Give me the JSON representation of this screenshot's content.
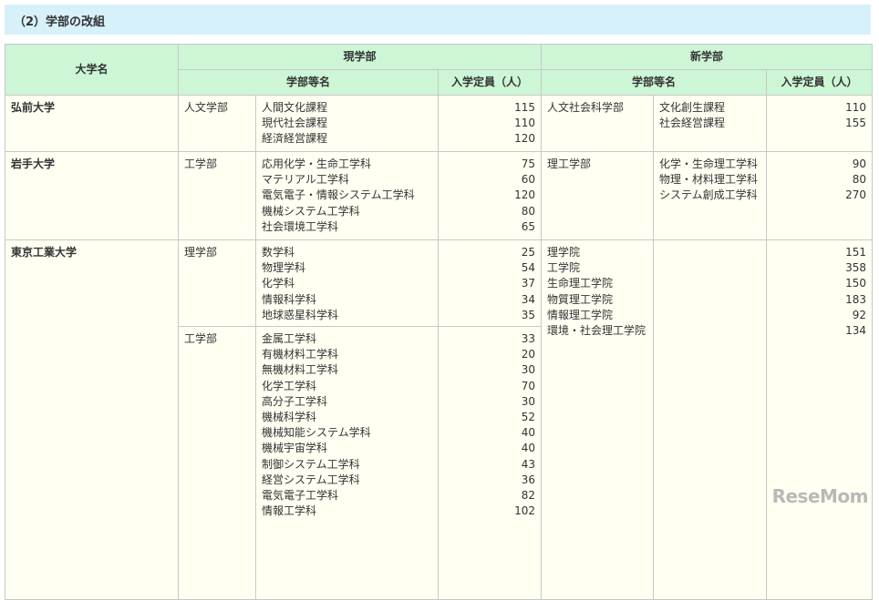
{
  "section_title": "（2）学部の改組",
  "table": {
    "headers": {
      "university": "大学名",
      "current": "現学部",
      "new": "新学部",
      "faculty_name": "学部等名",
      "capacity": "入学定員（人）"
    },
    "rows": [
      {
        "university": "弘前大学",
        "current": [
          {
            "faculty": "人文学部",
            "departments": [
              "人間文化課程",
              "現代社会課程",
              "経済経営課程"
            ],
            "capacities": [
              "115",
              "110",
              "120"
            ]
          }
        ],
        "new": {
          "faculty": [
            "人文社会科学部"
          ],
          "departments": [
            "文化創生課程",
            "社会経営課程"
          ],
          "capacities": [
            "110",
            "155"
          ]
        }
      },
      {
        "university": "岩手大学",
        "current": [
          {
            "faculty": "工学部",
            "departments": [
              "応用化学・生命工学科",
              "マテリアル工学科",
              "電気電子・情報システム工学科",
              "機械システム工学科",
              "社会環境工学科"
            ],
            "capacities": [
              "75",
              "60",
              "120",
              "80",
              "65"
            ]
          }
        ],
        "new": {
          "faculty": [
            "理工学部"
          ],
          "departments": [
            "化学・生命理工学科",
            "物理・材料理工学科",
            "システム創成工学科"
          ],
          "capacities": [
            "90",
            "80",
            "270"
          ]
        }
      },
      {
        "university": "東京工業大学",
        "current": [
          {
            "faculty": "理学部",
            "departments": [
              "数学科",
              "物理学科",
              "化学科",
              "情報科学科",
              "地球惑星科学科"
            ],
            "capacities": [
              "25",
              "54",
              "37",
              "34",
              "35"
            ]
          },
          {
            "faculty": "工学部",
            "departments": [
              "金属工学科",
              "有機材料工学科",
              "無機材料工学科",
              "化学工学科",
              "高分子工学科",
              "機械科学科",
              "機械知能システム学科",
              "機械宇宙学科",
              "制御システム工学科",
              "経営システム工学科",
              "電気電子工学科",
              "情報工学科"
            ],
            "capacities": [
              "33",
              "20",
              "30",
              "70",
              "30",
              "52",
              "40",
              "40",
              "43",
              "36",
              "82",
              "102"
            ]
          }
        ],
        "new": {
          "faculty": [
            "理学院",
            "工学院",
            "生命理工学院",
            "物質理工学院",
            "情報理工学院",
            "環境・社会理工学院"
          ],
          "departments": [],
          "capacities": [
            "151",
            "358",
            "150",
            "183",
            "92",
            "134"
          ]
        }
      }
    ]
  },
  "watermark": "ReseMom"
}
